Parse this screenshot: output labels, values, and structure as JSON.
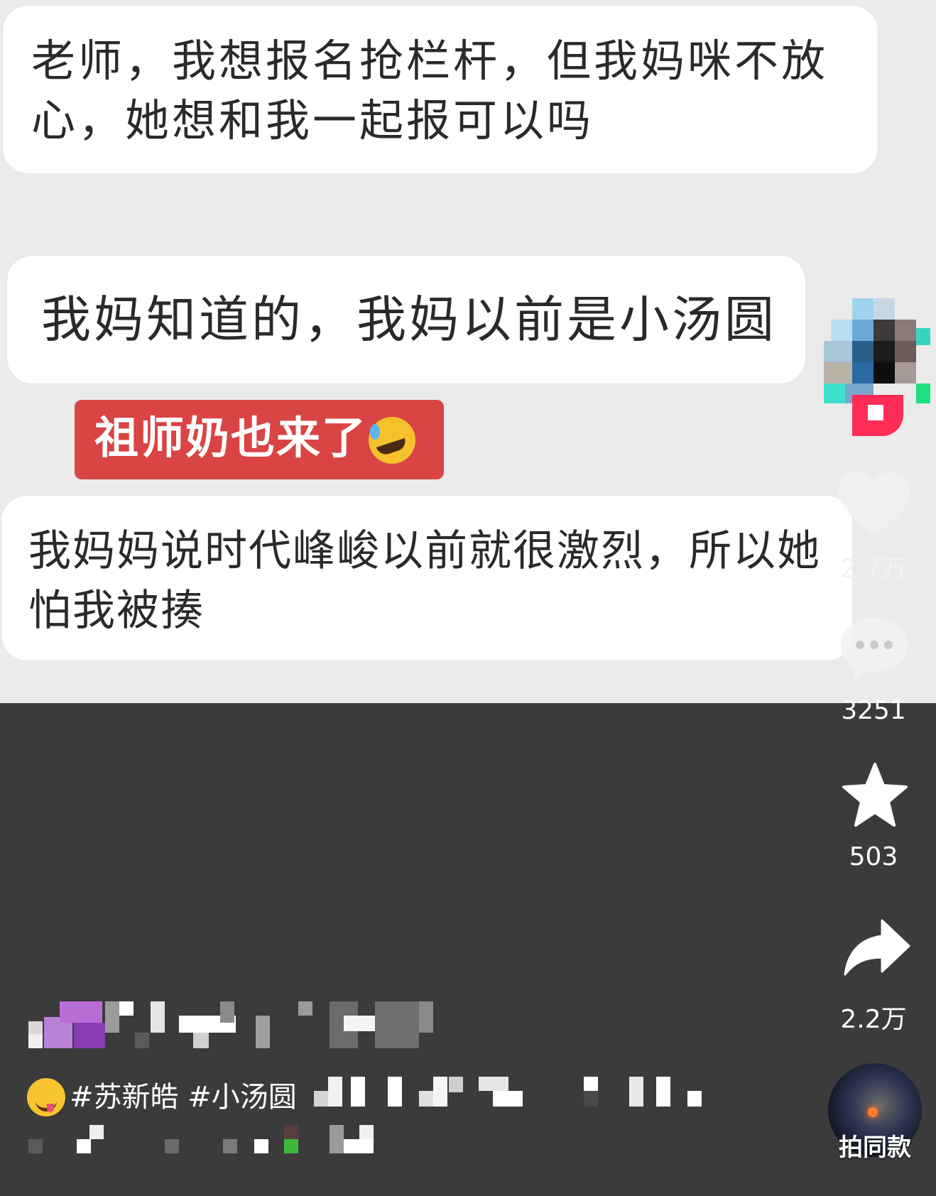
{
  "video": {
    "messages": [
      "老师，我想报名抢栏杆，但我妈咪不放心，她想和我一起报可以吗",
      "我妈知道的，我妈以前是小汤圆",
      "我妈妈说时代峰峻以前就很激烈，所以她怕我被揍"
    ],
    "caption": "祖师奶也来了"
  },
  "actions": {
    "like_count": "2.7万",
    "comment_count": "3251",
    "favorite_count": "503",
    "share_count": "2.2万",
    "music_label": "拍同款"
  },
  "description": {
    "hashtags": "#苏新皓 #小汤圆"
  },
  "icons": {
    "like": "heart-icon",
    "comment": "comment-bubble-icon",
    "favorite": "star-icon",
    "share": "share-arrow-icon"
  },
  "colors": {
    "caption_bg": "#d94444",
    "bubble_bg": "#ffffff",
    "video_bg": "#ebebeb",
    "panel_bg": "#3b3b3b"
  }
}
